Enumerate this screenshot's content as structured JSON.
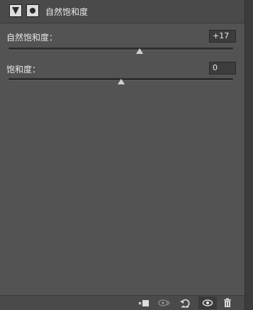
{
  "header": {
    "title": "自然饱和度",
    "adjustment_icon": "triangle-adjustment-icon",
    "mask_icon": "layer-mask-icon"
  },
  "vibrance": {
    "label": "自然饱和度：",
    "value": "+17",
    "level": 17,
    "min": -100,
    "max": 100
  },
  "saturation": {
    "label": "饱和度：",
    "value": "0",
    "level": 0,
    "min": -100,
    "max": 100
  },
  "footer": {
    "buttons": [
      {
        "icon": "clip-to-layer-icon",
        "pressed": false
      },
      {
        "icon": "view-previous-state-icon",
        "pressed": false
      },
      {
        "icon": "reset-icon",
        "pressed": false
      },
      {
        "icon": "toggle-visibility-icon",
        "pressed": true
      },
      {
        "icon": "trash-icon",
        "pressed": false
      }
    ]
  },
  "colors": {
    "panel": "#535353",
    "header": "#4a4a4a",
    "track": "#2e2e2e",
    "thumb": "#d0d0d0"
  }
}
